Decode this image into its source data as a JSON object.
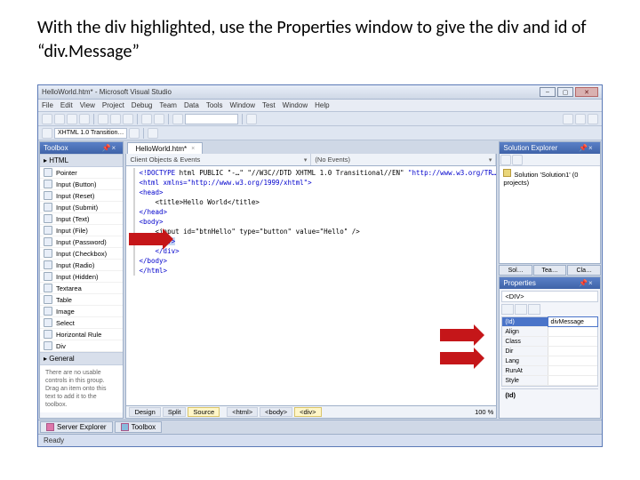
{
  "instruction": "With the div highlighted, use the Properties window to give the div and id of “div.Message”",
  "window": {
    "title": "HelloWorld.htm* - Microsoft Visual Studio",
    "menus": [
      "File",
      "Edit",
      "View",
      "Project",
      "Debug",
      "Team",
      "Data",
      "Tools",
      "Window",
      "Test",
      "Window",
      "Help"
    ]
  },
  "toolbar_dropdown": "XHTML 1.0 Transition…",
  "toolbox": {
    "title": "Toolbox",
    "cat_html": "▸ HTML",
    "items": [
      "Pointer",
      "Input (Button)",
      "Input (Reset)",
      "Input (Submit)",
      "Input (Text)",
      "Input (File)",
      "Input (Password)",
      "Input (Checkbox)",
      "Input (Radio)",
      "Input (Hidden)",
      "Textarea",
      "Table",
      "Image",
      "Select",
      "Horizontal Rule",
      "Div"
    ],
    "cat_general": "▸ General",
    "general_text": "There are no usable controls in this group. Drag an item onto this text to add it to the toolbox."
  },
  "editor": {
    "tab": "HelloWorld.htm*",
    "dd_left": "Client Objects & Events",
    "dd_right": "(No Events)",
    "code": {
      "l1_a": "<!DOCTYPE",
      "l1_b": " html PUBLIC \"-…\" \"//W3C//DTD XHTML 1.0 Transitional//EN\" ",
      "l1_c": "\"http://www.w3.org/TR…",
      "l2": "<html xmlns=\"http://www.w3.org/1999/xhtml\">",
      "l3": "<head>",
      "l4": "    <title>Hello World</title>",
      "l5": "</head>",
      "l6": "<body>",
      "l7": "    <input id=\"btnHello\" type=\"button\" value=\"Hello\" />",
      "l8a": "    ",
      "l8b": "<div>",
      "l9": "    </div>",
      "l10": "</body>",
      "l11": "</html>"
    },
    "zoom": "100 %",
    "views": [
      "Design",
      "Split",
      "Source"
    ],
    "crumbs": [
      "<html>",
      "<body>",
      "<div>"
    ]
  },
  "solution": {
    "title": "Solution Explorer",
    "line": "Solution 'Solution1' (0 projects)"
  },
  "right_tabs": [
    "Sol…",
    "Tea…",
    "Cla…"
  ],
  "props": {
    "title": "Properties",
    "selected": "<DIV>",
    "rows": [
      {
        "name": "(Id)",
        "value": "divMessage",
        "sel": true
      },
      {
        "name": "Align",
        "value": ""
      },
      {
        "name": "Class",
        "value": ""
      },
      {
        "name": "Dir",
        "value": ""
      },
      {
        "name": "Lang",
        "value": ""
      },
      {
        "name": "RunAt",
        "value": ""
      },
      {
        "name": "Style",
        "value": ""
      }
    ],
    "help": "(Id)"
  },
  "bottom_tabs": [
    "Server Explorer",
    "Toolbox"
  ],
  "status": "Ready"
}
